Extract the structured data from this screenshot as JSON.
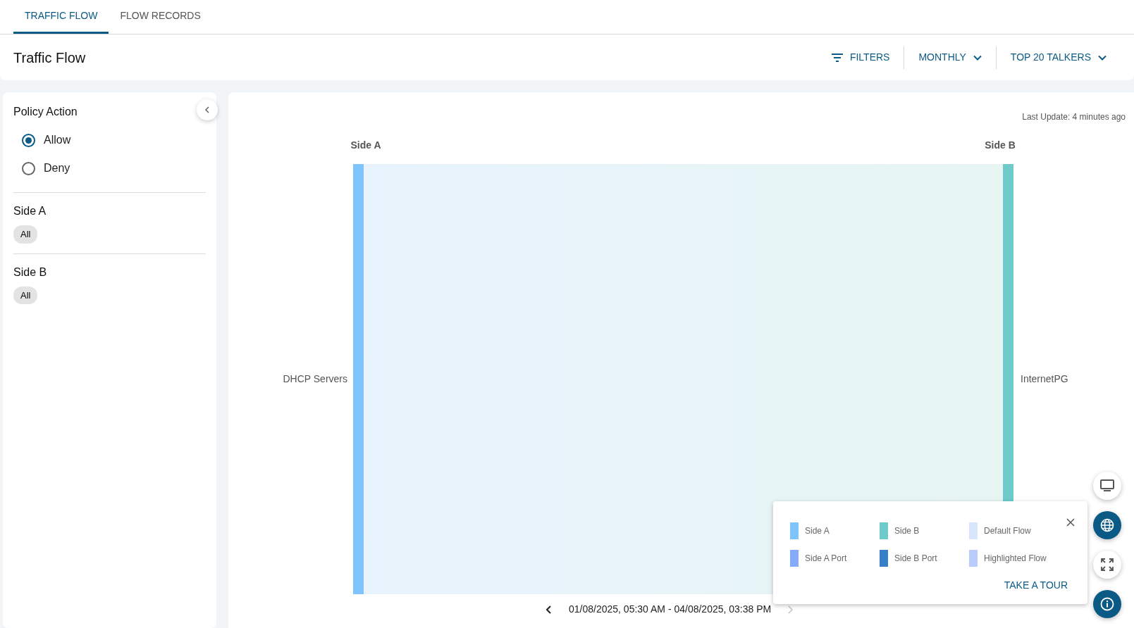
{
  "tabs": [
    {
      "label": "TRAFFIC FLOW",
      "selected": true
    },
    {
      "label": "FLOW RECORDS",
      "selected": false
    }
  ],
  "header": {
    "title": "Traffic Flow",
    "actions": [
      {
        "kind": "filter",
        "label": "FILTERS"
      },
      {
        "kind": "dropdown",
        "label": "MONTHLY"
      },
      {
        "kind": "dropdown",
        "label": "TOP 20 TALKERS"
      }
    ]
  },
  "sidebar": {
    "sections": [
      {
        "title": "Policy Action",
        "kind": "radios",
        "options": [
          {
            "label": "Allow",
            "selected": true
          },
          {
            "label": "Deny",
            "selected": false
          }
        ]
      },
      {
        "title": "Side A",
        "kind": "chips",
        "chips": [
          "All"
        ]
      },
      {
        "title": "Side B",
        "kind": "chips",
        "chips": [
          "All"
        ]
      }
    ]
  },
  "diagram": {
    "last_update": "Last Update: 4 minutes ago",
    "column_left": "Side A",
    "column_right": "Side B",
    "node_left": "DHCP Servers",
    "node_right": "InternetPG",
    "date_range": "01/08/2025, 05:30 AM - 04/08/2025, 03:38 PM",
    "prev_disabled": false,
    "next_disabled": true
  },
  "legend": {
    "items": [
      {
        "label": "Side A",
        "color": "#7fc4fd"
      },
      {
        "label": "Side B",
        "color": "#6ecbca"
      },
      {
        "label": "Default Flow",
        "color": "#d8e5fd"
      },
      {
        "label": "Side A Port",
        "color": "#84aafc"
      },
      {
        "label": "Side B Port",
        "color": "#347fc8"
      },
      {
        "label": "Highlighted Flow",
        "color": "#b8cdfb"
      }
    ],
    "link": "TAKE A TOUR"
  },
  "fab_buttons": [
    {
      "kind": "monitor",
      "selected": false
    },
    {
      "kind": "globe",
      "selected": true
    },
    {
      "kind": "expand",
      "selected": false
    },
    {
      "kind": "info",
      "selected": true
    }
  ]
}
